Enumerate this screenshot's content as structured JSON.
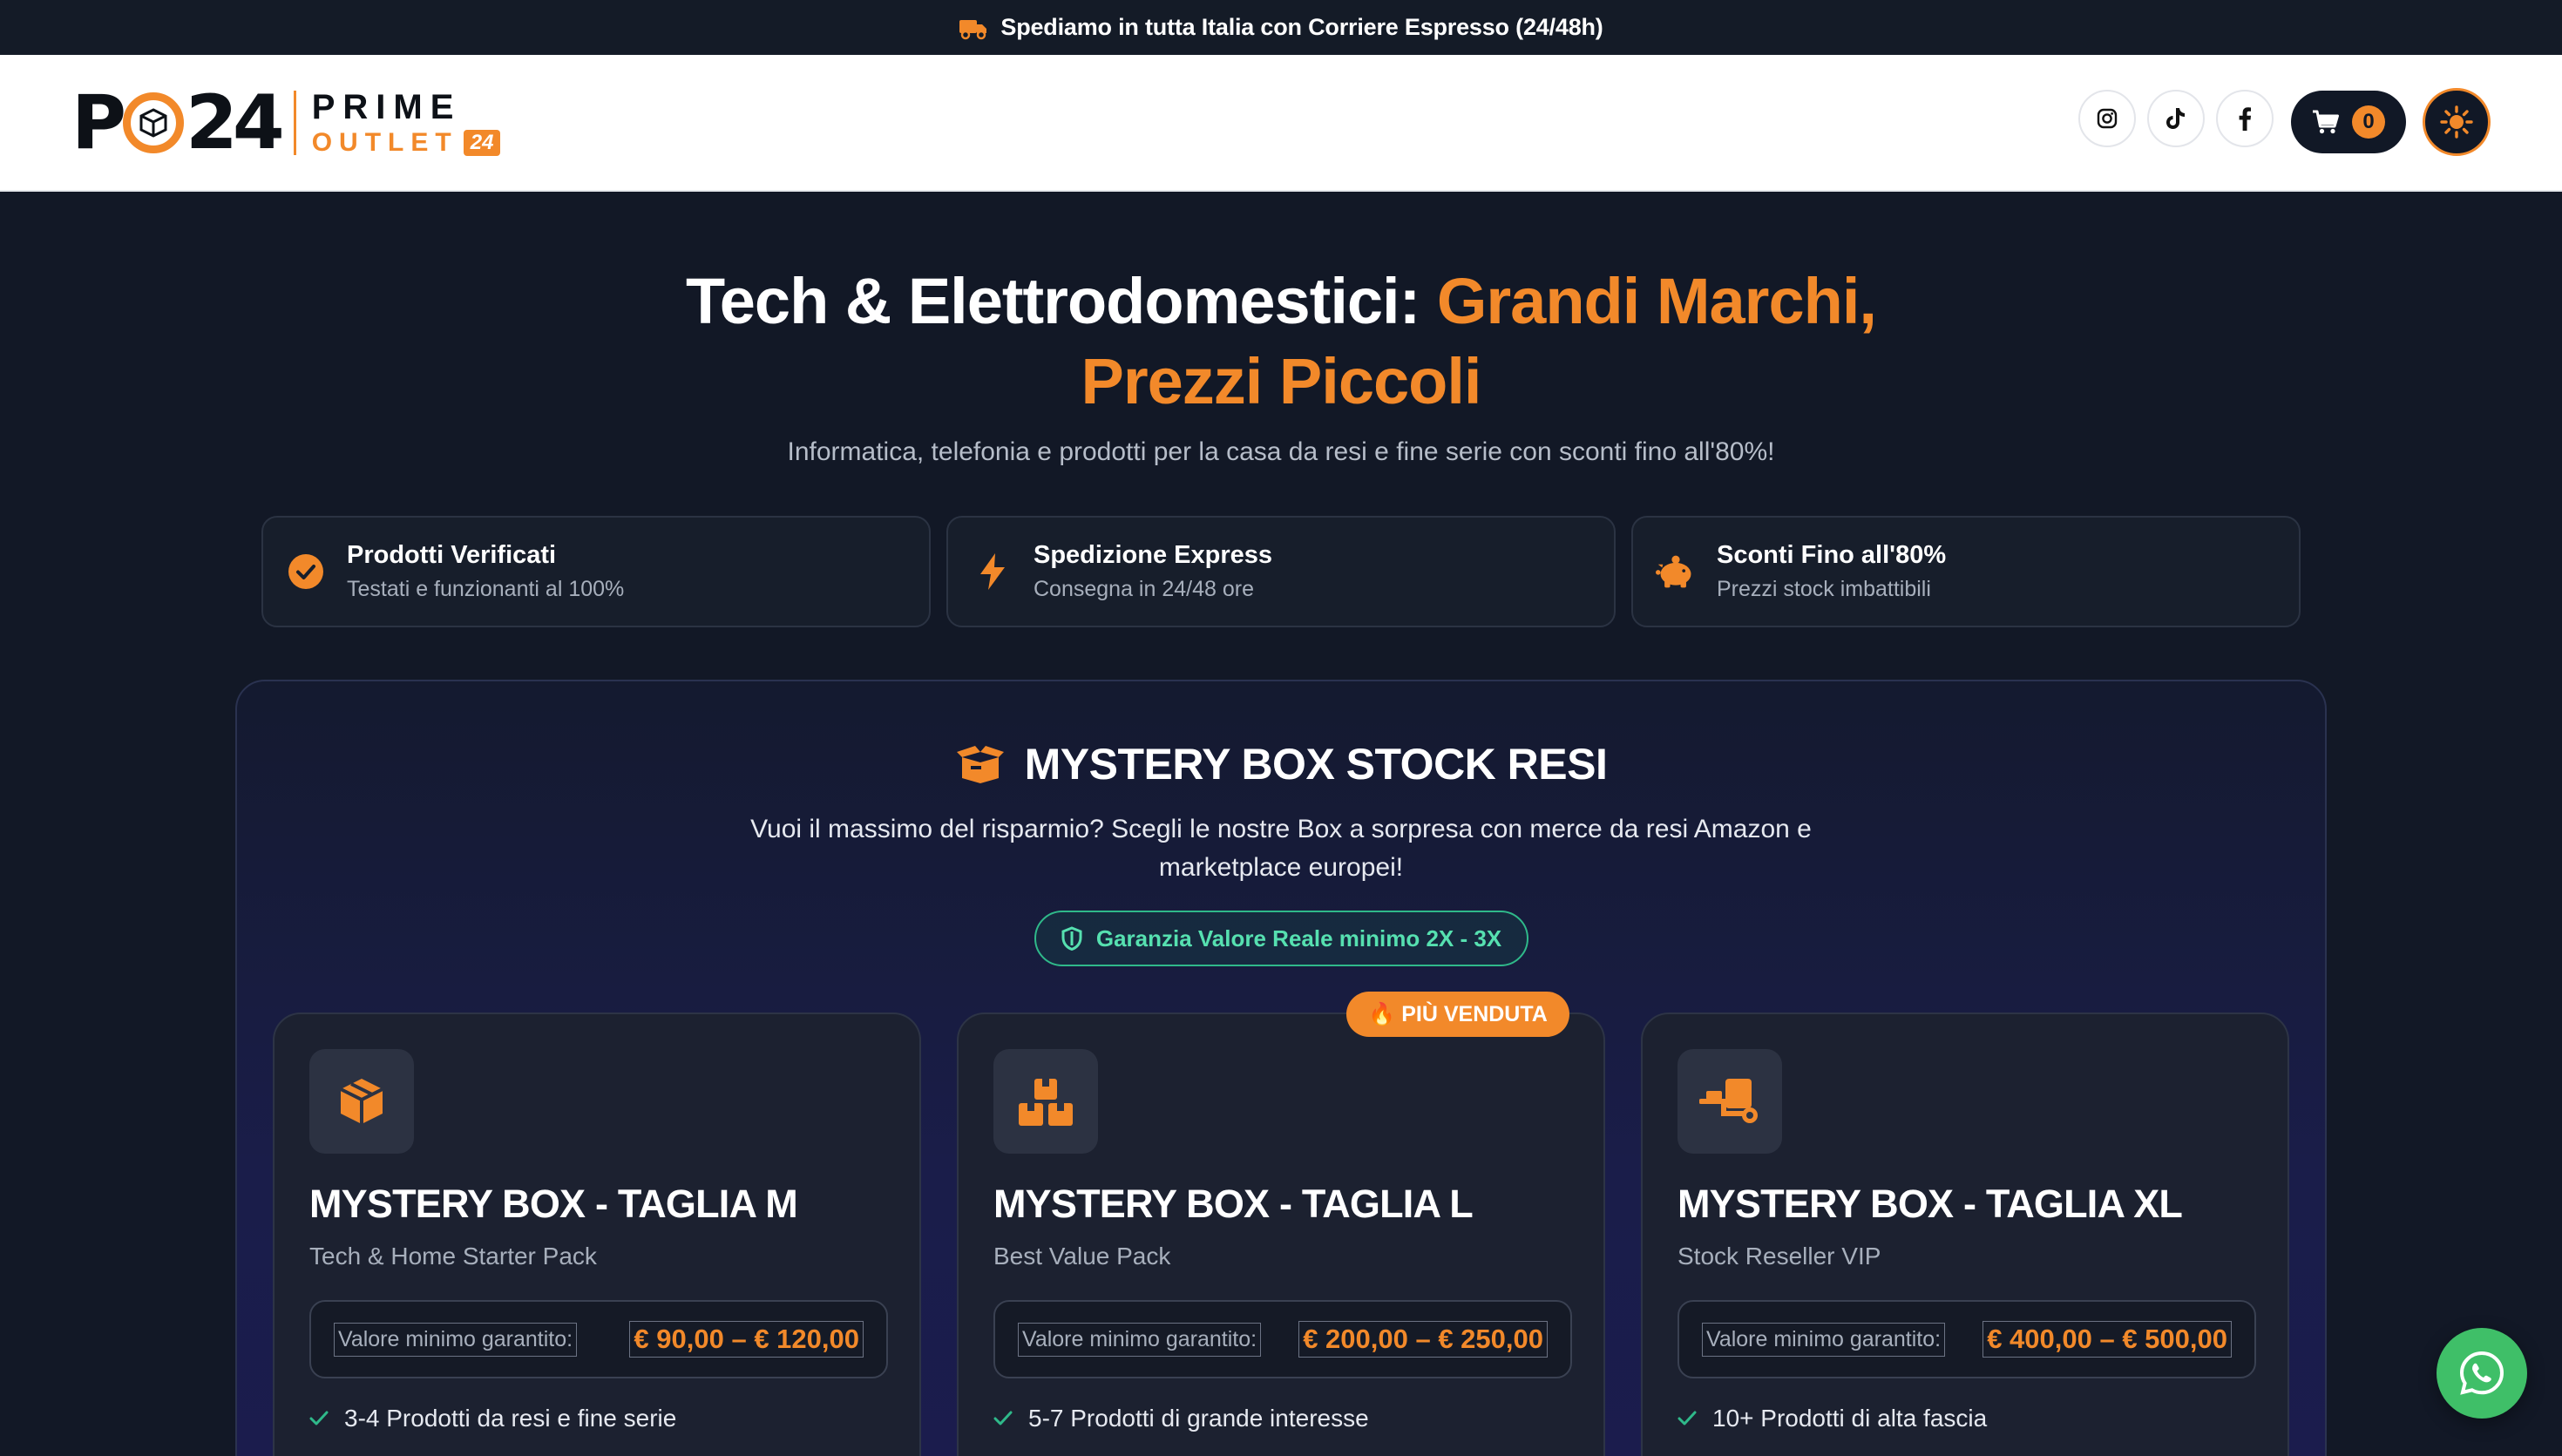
{
  "topbar": {
    "text": "Spediamo in tutta Italia con Corriere Espresso (24/48h)",
    "icon": "truck-icon"
  },
  "header": {
    "logo": {
      "mark_left": "P",
      "mark_right": "24",
      "prime": "PRIME",
      "outlet": "OUTLET",
      "badge": "24"
    },
    "social": [
      "instagram-icon",
      "tiktok-icon",
      "facebook-icon"
    ],
    "cart": {
      "count": "0",
      "icon": "cart-icon"
    },
    "theme_icon": "sun-icon"
  },
  "hero": {
    "title_part1": "Tech & Elettrodomestici: ",
    "title_accent1": "Grandi Marchi,",
    "title_accent2": "Prezzi Piccoli",
    "subtitle": "Informatica, telefonia e prodotti per la casa da resi e fine serie con sconti fino all'80%!"
  },
  "features": [
    {
      "title": "Prodotti Verificati",
      "desc": "Testati e funzionanti al 100%",
      "icon": "check-circle-icon"
    },
    {
      "title": "Spedizione Express",
      "desc": "Consegna in 24/48 ore",
      "icon": "bolt-icon"
    },
    {
      "title": "Sconti Fino all'80%",
      "desc": "Prezzi stock imbattibili",
      "icon": "piggy-bank-icon"
    }
  ],
  "mystery": {
    "title": "MYSTERY BOX STOCK RESI",
    "subtitle": "Vuoi il massimo del risparmio? Scegli le nostre Box a sorpresa con merce da resi Amazon e marketplace europei!",
    "guarantee": "Garanzia Valore Reale minimo 2X - 3X",
    "hot_badge": "🔥 PIÙ VENDUTA",
    "cards": [
      {
        "title": "MYSTERY BOX - TAGLIA M",
        "subtitle": "Tech & Home Starter Pack",
        "price_label": "Valore minimo garantito:",
        "price": "€ 90,00 – € 120,00",
        "feature": "3-4 Prodotti da resi e fine serie",
        "icon": "box-icon"
      },
      {
        "title": "MYSTERY BOX - TAGLIA L",
        "subtitle": "Best Value Pack",
        "price_label": "Valore minimo garantito:",
        "price": "€ 200,00 – € 250,00",
        "feature": "5-7 Prodotti di grande interesse",
        "icon": "boxes-icon"
      },
      {
        "title": "MYSTERY BOX - TAGLIA XL",
        "subtitle": "Stock Reseller VIP",
        "price_label": "Valore minimo garantito:",
        "price": "€ 400,00 – € 500,00",
        "feature": "10+ Prodotti di alta fascia",
        "icon": "dolly-icon"
      }
    ]
  },
  "colors": {
    "accent": "#f2892a",
    "bg": "#121826",
    "success": "#56e0b0",
    "whatsapp": "#3fbf68"
  }
}
